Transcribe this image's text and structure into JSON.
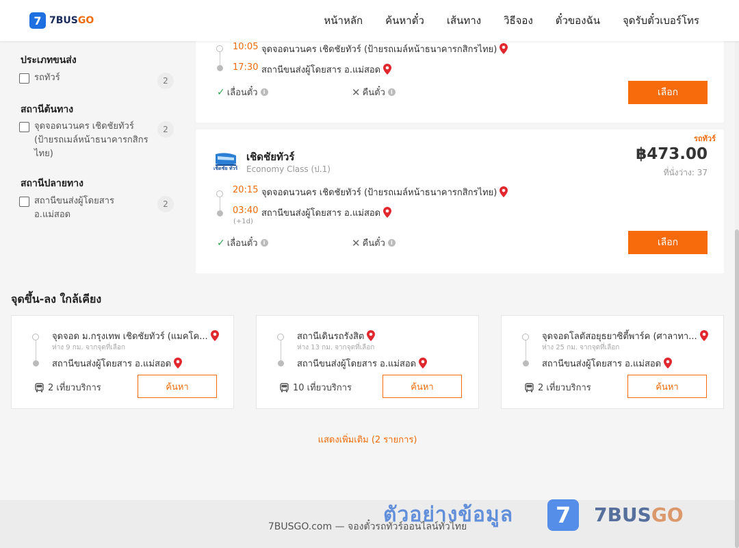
{
  "header": {
    "logo_number": "7",
    "logo_main": "7BUS",
    "logo_go": "GO",
    "nav": [
      "หน้าหลัก",
      "ค้นหาตั๋ว",
      "เส้นทาง",
      "วิธีจอง",
      "ตั๋วของฉัน",
      "จุดรับตั๋วเบอร์โทร"
    ]
  },
  "sidebar": {
    "groups": [
      {
        "title": "ประเภทขนส่ง",
        "items": [
          {
            "label": "รถทัวร์",
            "count": "2"
          }
        ]
      },
      {
        "title": "สถานีต้นทาง",
        "items": [
          {
            "label": "จุดจอดนวนคร เชิดชัยทัวร์ (ป้ายรถเมล์หน้าธนาคารกสิกรไทย)",
            "count": "2"
          }
        ]
      },
      {
        "title": "สถานีปลายทาง",
        "items": [
          {
            "label": "สถานีขนส่งผู้โดยสาร อ.แม่สอด",
            "count": "2"
          }
        ]
      }
    ]
  },
  "trips": [
    {
      "depart_time": "10:05",
      "depart_station": "จุดจอดนวนคร เชิดชัยทัวร์ (ป้ายรถเมล์หน้าธนาคารกสิกรไทย)",
      "arrive_time": "17:30",
      "arrive_station": "สถานีขนส่งผู้โดยสาร อ.แม่สอด",
      "change_label": "เลื่อนตั๋ว",
      "refund_label": "คืนตั๋ว",
      "select_label": "เลือก"
    },
    {
      "badge": "รถทัวร์",
      "operator": "เชิดชัยทัวร์",
      "logo_caption": "เชิดชัย ทัวร์",
      "bus_class": "Economy Class (ป.1)",
      "price": "฿473.00",
      "seats": "ที่นั่งว่าง: 37",
      "depart_time": "20:15",
      "depart_station": "จุดจอดนวนคร เชิดชัยทัวร์ (ป้ายรถเมล์หน้าธนาคารกสิกรไทย)",
      "arrive_time": "03:40",
      "arrive_extra": "(+1d)",
      "arrive_station": "สถานีขนส่งผู้โดยสาร อ.แม่สอด",
      "change_label": "เลื่อนตั๋ว",
      "refund_label": "คืนตั๋ว",
      "select_label": "เลือก"
    }
  ],
  "nearby": {
    "title": "จุดขึ้น-ลง ใกล้เคียง",
    "cards": [
      {
        "from": "จุดจอด ม.กรุงเทพ เชิดชัยทัวร์ (แมคโค...",
        "distance": "ห่าง 9 กม. จากจุดที่เลือก",
        "to": "สถานีขนส่งผู้โดยสาร อ.แม่สอด",
        "trips": "2 เที่ยวบริการ",
        "button": "ค้นหา"
      },
      {
        "from": "สถานีเดินรถรังสิต",
        "distance": "ห่าง 13 กม. จากจุดที่เลือก",
        "to": "สถานีขนส่งผู้โดยสาร อ.แม่สอด",
        "trips": "10 เที่ยวบริการ",
        "button": "ค้นหา"
      },
      {
        "from": "จุดจอดโลตัสอยุธยาซิตี้พาร์ค (ศาลาทา...",
        "distance": "ห่าง 25 กม. จากจุดที่เลือก",
        "to": "สถานีขนส่งผู้โดยสาร อ.แม่สอด",
        "trips": "2 เที่ยวบริการ",
        "button": "ค้นหา"
      }
    ],
    "show_more": "แสดงเพิ่มเติม (2 รายการ)"
  },
  "footer": {
    "text": "7BUSGO.com — จองตั๋วรถทัวร์ออนไลน์ทั่วไทย"
  },
  "watermark": {
    "text": "ตัวอย่างข้อมูล",
    "logo_number": "7",
    "brand_main": "7BUS",
    "brand_go": "GO"
  },
  "colors": {
    "accent": "#f76b0d",
    "brand_blue": "#1e6fe0",
    "pin_red": "#e0282e"
  }
}
